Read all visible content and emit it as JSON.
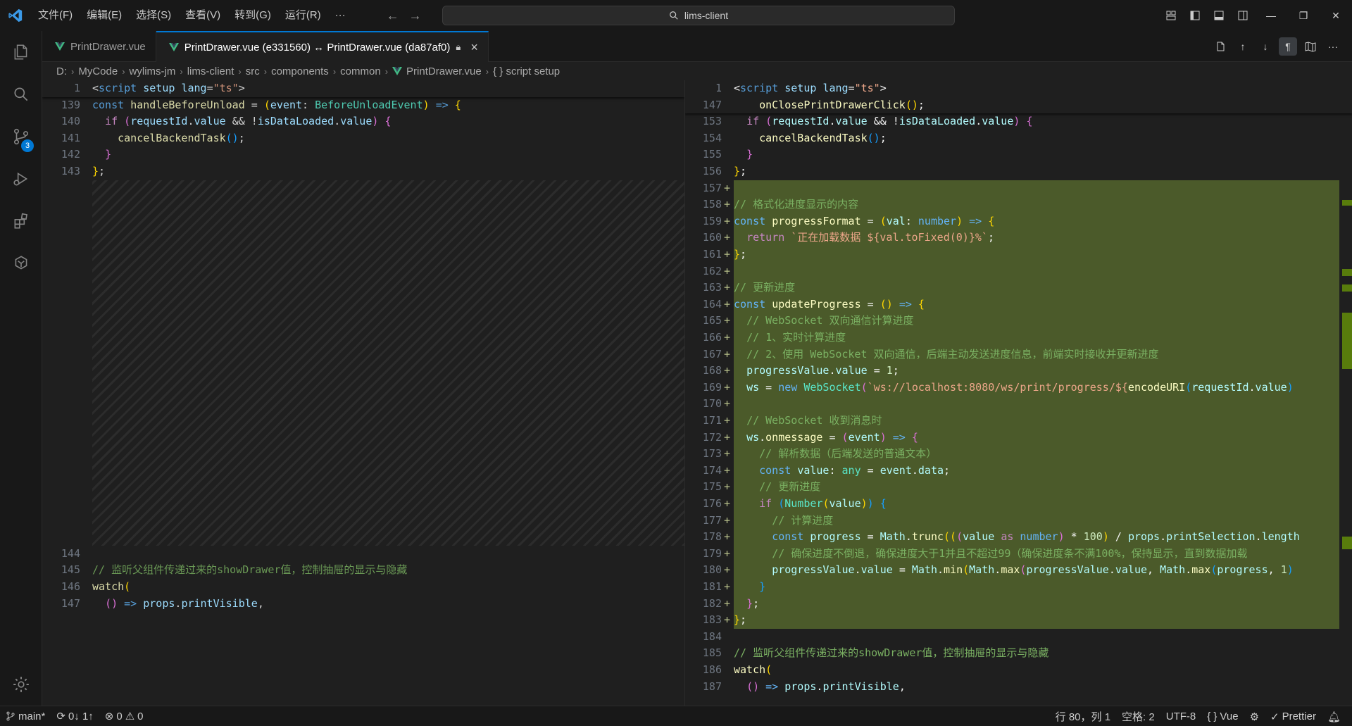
{
  "titlebar": {
    "menu": [
      "文件(F)",
      "编辑(E)",
      "选择(S)",
      "查看(V)",
      "转到(G)",
      "运行(R)",
      "···"
    ],
    "search_text": "lims-client"
  },
  "activity": {
    "source_control_badge": "3"
  },
  "tabs": [
    {
      "label": "PrintDrawer.vue",
      "active": false
    },
    {
      "label": "PrintDrawer.vue (e331560) ↔ PrintDrawer.vue (da87af0)",
      "active": true
    }
  ],
  "breadcrumb": [
    "D:",
    "MyCode",
    "wylims-jm",
    "lims-client",
    "src",
    "components",
    "common",
    "PrintDrawer.vue",
    "{ } script setup"
  ],
  "left_editor": {
    "sticky_line_number": "1",
    "lines": [
      {
        "n": "139"
      },
      {
        "n": "140"
      },
      {
        "n": "141"
      },
      {
        "n": "142"
      },
      {
        "n": "143"
      },
      {
        "n": "144"
      },
      {
        "n": "145"
      },
      {
        "n": "146"
      },
      {
        "n": "147"
      }
    ],
    "comment_145": "// 监听父组件传递过来的showDrawer值，控制抽屉的显示与隐藏"
  },
  "right_editor": {
    "sticky_line_number_1": "1",
    "sticky_line_number_2": "147",
    "lines": [
      {
        "n": "153"
      },
      {
        "n": "154"
      },
      {
        "n": "155"
      },
      {
        "n": "156"
      },
      {
        "n": "157"
      },
      {
        "n": "158"
      },
      {
        "n": "159"
      },
      {
        "n": "160"
      },
      {
        "n": "161"
      },
      {
        "n": "162"
      },
      {
        "n": "163"
      },
      {
        "n": "164"
      },
      {
        "n": "165"
      },
      {
        "n": "166"
      },
      {
        "n": "167"
      },
      {
        "n": "168"
      },
      {
        "n": "169"
      },
      {
        "n": "170"
      },
      {
        "n": "171"
      },
      {
        "n": "172"
      },
      {
        "n": "173"
      },
      {
        "n": "174"
      },
      {
        "n": "175"
      },
      {
        "n": "176"
      },
      {
        "n": "177"
      },
      {
        "n": "178"
      },
      {
        "n": "179"
      },
      {
        "n": "180"
      },
      {
        "n": "181"
      },
      {
        "n": "182"
      },
      {
        "n": "183"
      },
      {
        "n": "184"
      },
      {
        "n": "185"
      },
      {
        "n": "186"
      },
      {
        "n": "187"
      }
    ],
    "comment_158": "// 格式化进度显示的内容",
    "str_160": "`正在加载数据 ${val.toFixed(0)}%`",
    "comment_163": "// 更新进度",
    "comment_165": "// WebSocket 双向通信计算进度",
    "comment_166": "// 1、实时计算进度",
    "comment_167": "// 2、使用 WebSocket 双向通信，后端主动发送进度信息，前端实时接收并更新进度",
    "comment_171": "// WebSocket 收到消息时",
    "comment_173": "// 解析数据（后端发送的普通文本）",
    "comment_175": "// 更新进度",
    "comment_177": "// 计算进度",
    "comment_179": "// 确保进度不倒退，确保进度大于1并且不超过99（确保进度条不满100%，保持显示，直到数据加载",
    "comment_185": "// 监听父组件传递过来的showDrawer值，控制抽屉的显示与隐藏",
    "ws_url": "`ws://localhost:8080/ws/print/progress/${"
  },
  "statusbar": {
    "branch": "main*",
    "sync": "0↓ 1↑",
    "errors": "0",
    "warnings": "0",
    "position": "行 80，列 1",
    "spaces": "空格: 2",
    "encoding": "UTF-8",
    "language": "Vue",
    "formatter": "Prettier"
  }
}
